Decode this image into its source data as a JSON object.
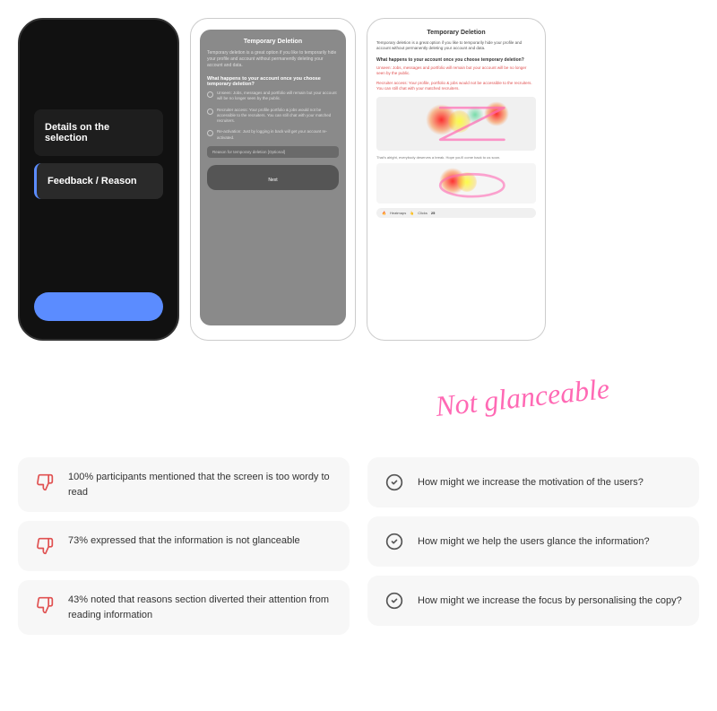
{
  "top": {
    "phones": {
      "dark": {
        "menu_items": [
          {
            "label": "Details on the selection",
            "active": false
          },
          {
            "label": "Feedback / Reason",
            "active": false
          }
        ],
        "button_label": ""
      },
      "gray": {
        "title": "Temporary Deletion",
        "intro_text": "Temporary deletion is a great option if you like to temporarily hide your profile and account without permanently deleting your account and data.",
        "section": "What happens to your account once you choose temporary deletion?",
        "radio_items": [
          "Unseen: Jobs, messages and portfolio will remain but your account will be no longer seen by the public.",
          "Recruiter access: Your profile portfolio & jobs would not be accessible to the recruiters. You can still chat with your matched recruiters.",
          "Re-activation: Just by logging in back will get your account re-activated."
        ],
        "input_label": "Reason for temporary deletion [Optional]",
        "next_btn": "Next"
      },
      "white": {
        "title": "Temporary Deletion",
        "intro_text": "Temporary deletion is a great option if you like to temporarily hide your profile and account without permanently deleting your account and data.",
        "section": "What happens to your account once you choose temporary deletion?",
        "text_red_1": "Unseen: Jobs, messages and portfolio will remain but your account will be no longer seen by the public.",
        "text_red_2": "Recruiter access: Your profile, portfolio & jobs would not be accessible to the recruiters. You can still chat with your matched recruiters.",
        "small_text": "That's alright, everybody deserves a break. Hope you'll come back to us soon.",
        "bottom_bar_label": "Heatmaps",
        "clicks_label": "Clicks",
        "clicks_count": "25"
      }
    },
    "annotation": "Not glanceable"
  },
  "insights": [
    {
      "icon": "thumbs-down-icon",
      "text": "100% participants mentioned that the screen is too wordy to read"
    },
    {
      "icon": "thumbs-down-icon",
      "text": "73% expressed that the information is not glanceable"
    },
    {
      "icon": "thumbs-down-icon",
      "text": "43% noted that reasons section diverted their attention from reading information"
    }
  ],
  "hmw": [
    {
      "icon": "checkmark-icon",
      "text": "How might we increase the motivation of the users?"
    },
    {
      "icon": "checkmark-icon",
      "text": "How might we help the users glance the information?"
    },
    {
      "icon": "checkmark-icon",
      "text": "How might we increase the focus by personalising the copy?"
    }
  ]
}
